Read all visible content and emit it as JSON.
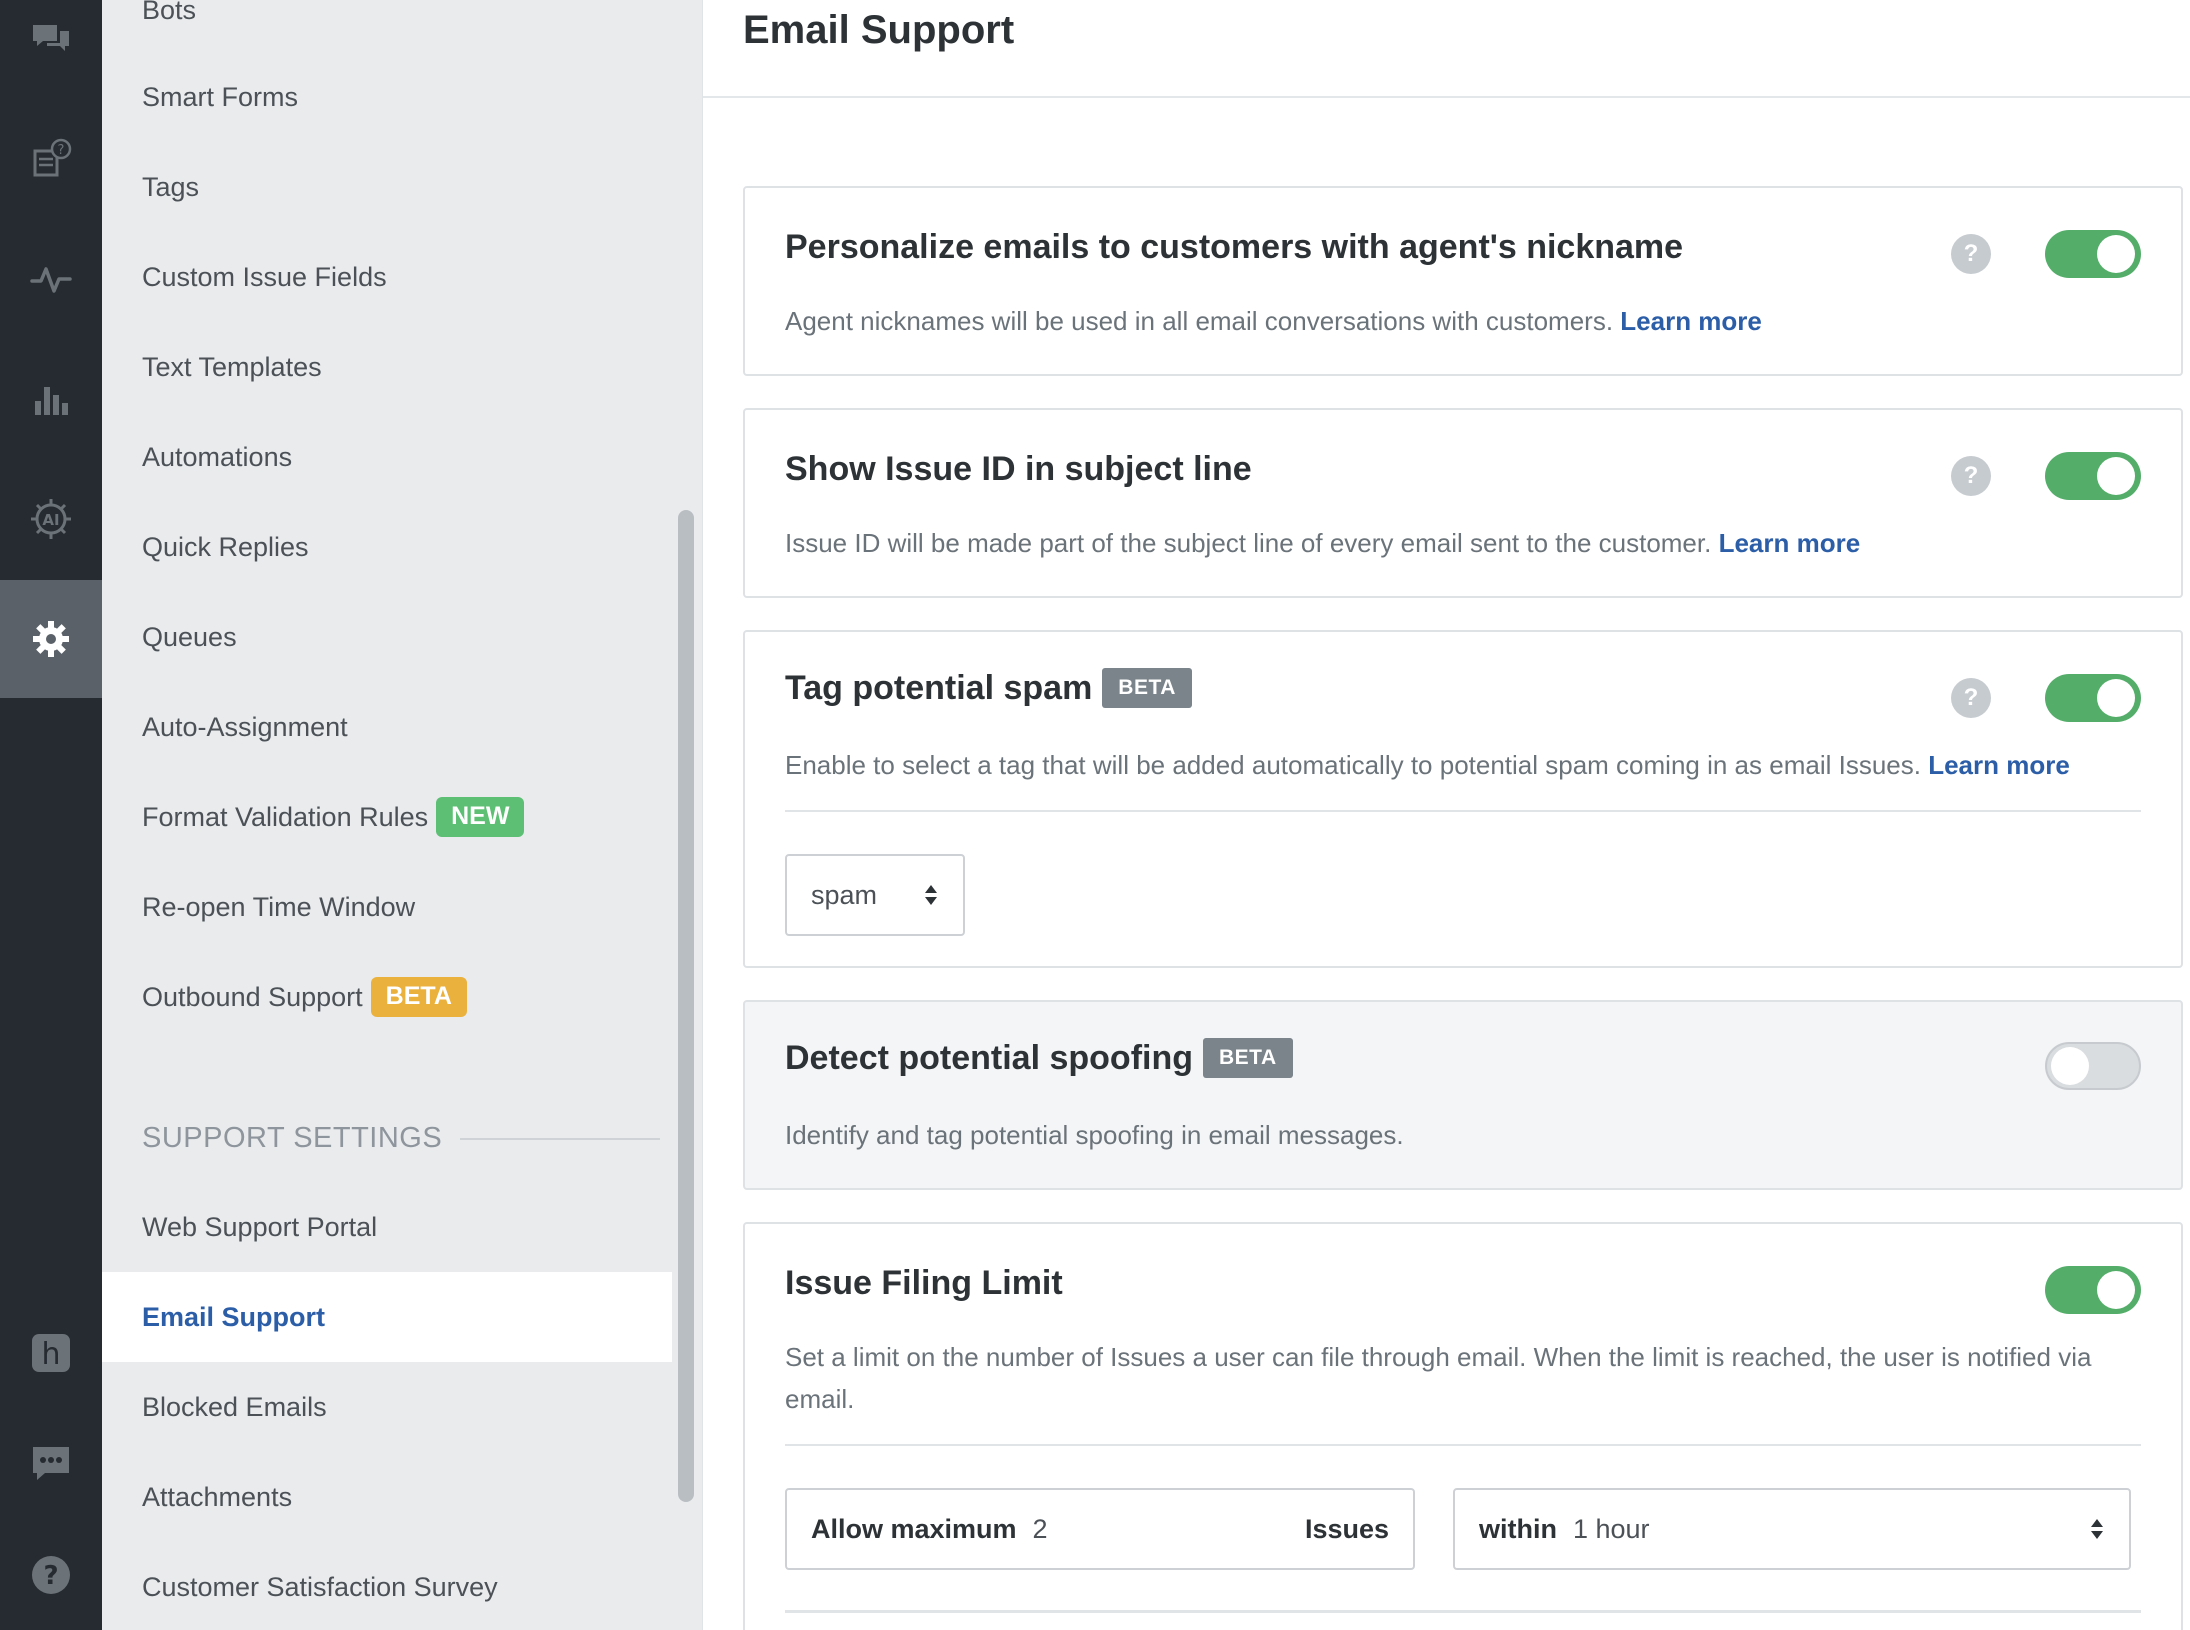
{
  "rail": {
    "items": [
      {
        "icon": "chat-bubbles-icon"
      },
      {
        "icon": "knowledge-base-icon"
      },
      {
        "icon": "activity-pulse-icon"
      },
      {
        "icon": "bar-chart-icon"
      },
      {
        "icon": "ai-icon",
        "text": "AI"
      },
      {
        "icon": "gear-icon",
        "active": true
      },
      {
        "icon": "helpshift-logo-icon",
        "text": "h"
      },
      {
        "icon": "message-dots-icon"
      },
      {
        "icon": "help-circle-icon",
        "text": "?"
      }
    ]
  },
  "nav": {
    "items": [
      {
        "label": "Bots"
      },
      {
        "label": "Smart Forms"
      },
      {
        "label": "Tags"
      },
      {
        "label": "Custom Issue Fields"
      },
      {
        "label": "Text Templates"
      },
      {
        "label": "Automations"
      },
      {
        "label": "Quick Replies"
      },
      {
        "label": "Queues"
      },
      {
        "label": "Auto-Assignment"
      },
      {
        "label": "Format Validation Rules",
        "badge": "NEW"
      },
      {
        "label": "Re-open Time Window"
      },
      {
        "label": "Outbound Support",
        "badge": "BETA"
      }
    ],
    "section_title": "SUPPORT SETTINGS",
    "support_items": [
      {
        "label": "Web Support Portal"
      },
      {
        "label": "Email Support",
        "active": true
      },
      {
        "label": "Blocked Emails"
      },
      {
        "label": "Attachments"
      },
      {
        "label": "Customer Satisfaction Survey"
      }
    ]
  },
  "main": {
    "page_title": "Email Support",
    "help_glyph": "?",
    "cards": [
      {
        "title": "Personalize emails to customers with agent's nickname",
        "description": "Agent nicknames will be used in all email conversations with customers.",
        "link": "Learn more",
        "enabled": true
      },
      {
        "title": "Show Issue ID in subject line",
        "description": "Issue ID will be made part of the subject line of every email sent to the customer.",
        "link": "Learn more",
        "enabled": true
      },
      {
        "title": "Tag potential spam",
        "badge": "BETA",
        "description": "Enable to select a tag that will be added automatically to potential spam coming in as email Issues.",
        "link": "Learn more",
        "enabled": true,
        "select_value": "spam"
      },
      {
        "title": "Detect potential spoofing",
        "badge": "BETA",
        "description": "Identify and tag potential spoofing in email messages.",
        "enabled": false
      },
      {
        "title": "Issue Filing Limit",
        "description": "Set a limit on the number of Issues a user can file through email. When the limit is reached, the user is notified via email.",
        "enabled": true,
        "limit": {
          "prefix": "Allow maximum",
          "value": "2",
          "suffix": "Issues",
          "within_label": "within",
          "within_value": "1 hour"
        }
      }
    ]
  }
}
